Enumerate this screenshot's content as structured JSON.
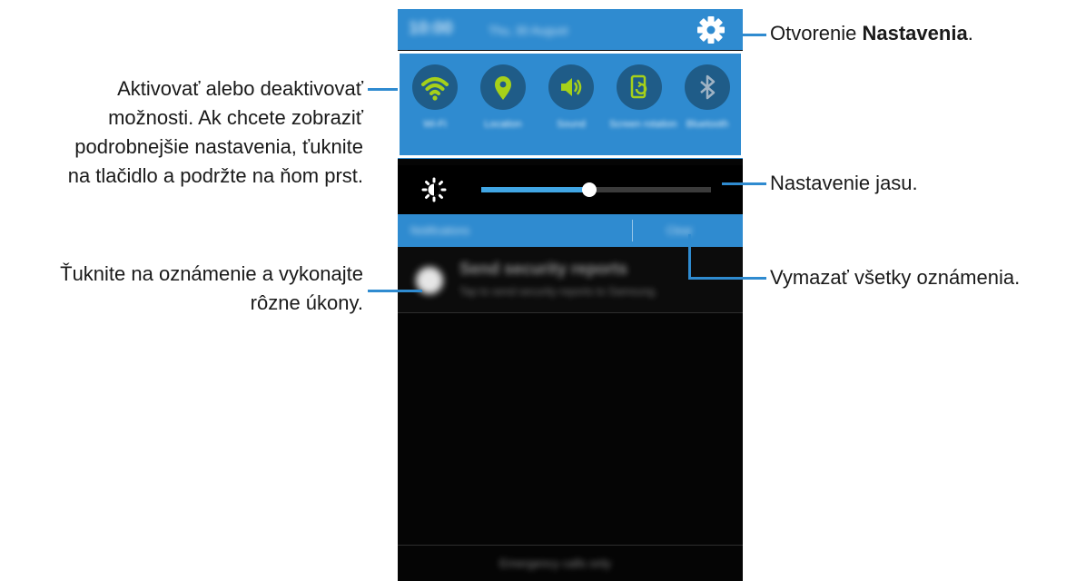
{
  "phone": {
    "status_time": "10:00",
    "status_date": "Thu, 30 August",
    "settings_icon": "gear-icon",
    "toggles": [
      {
        "label": "Wi-Fi",
        "icon": "wifi-icon"
      },
      {
        "label": "Location",
        "icon": "location-icon"
      },
      {
        "label": "Sound",
        "icon": "sound-icon"
      },
      {
        "label": "Screen rotation",
        "icon": "rotation-icon"
      },
      {
        "label": "Bluetooth",
        "icon": "bluetooth-icon"
      }
    ],
    "brightness": {
      "icon": "brightness-icon",
      "level": 0.47
    },
    "notifications_header": {
      "title": "Notifications",
      "clear_label": "Clear"
    },
    "notification": {
      "title": "Send security reports",
      "text": "Tap to send security reports to Samsung."
    },
    "bottom_text": "Emergency calls only"
  },
  "callouts": {
    "settings": {
      "prefix": "Otvorenie ",
      "bold": "Nastavenia",
      "suffix": "."
    },
    "toggles": [
      "Aktivovať alebo deaktivovať",
      "možnosti. Ak chcete zobraziť",
      "podrobnejšie nastavenia, ťuknite",
      "na tlačidlo a podržte na ňom prst."
    ],
    "brightness": "Nastavenie jasu.",
    "notification": [
      "Ťuknite na oznámenie a vykonajte",
      "rôzne úkony."
    ],
    "clear": "Vymazať všetky oznámenia."
  },
  "colors": {
    "accent": "#2f8bd0",
    "icon_green": "#a6d11a",
    "panel_dark": "#050505"
  }
}
